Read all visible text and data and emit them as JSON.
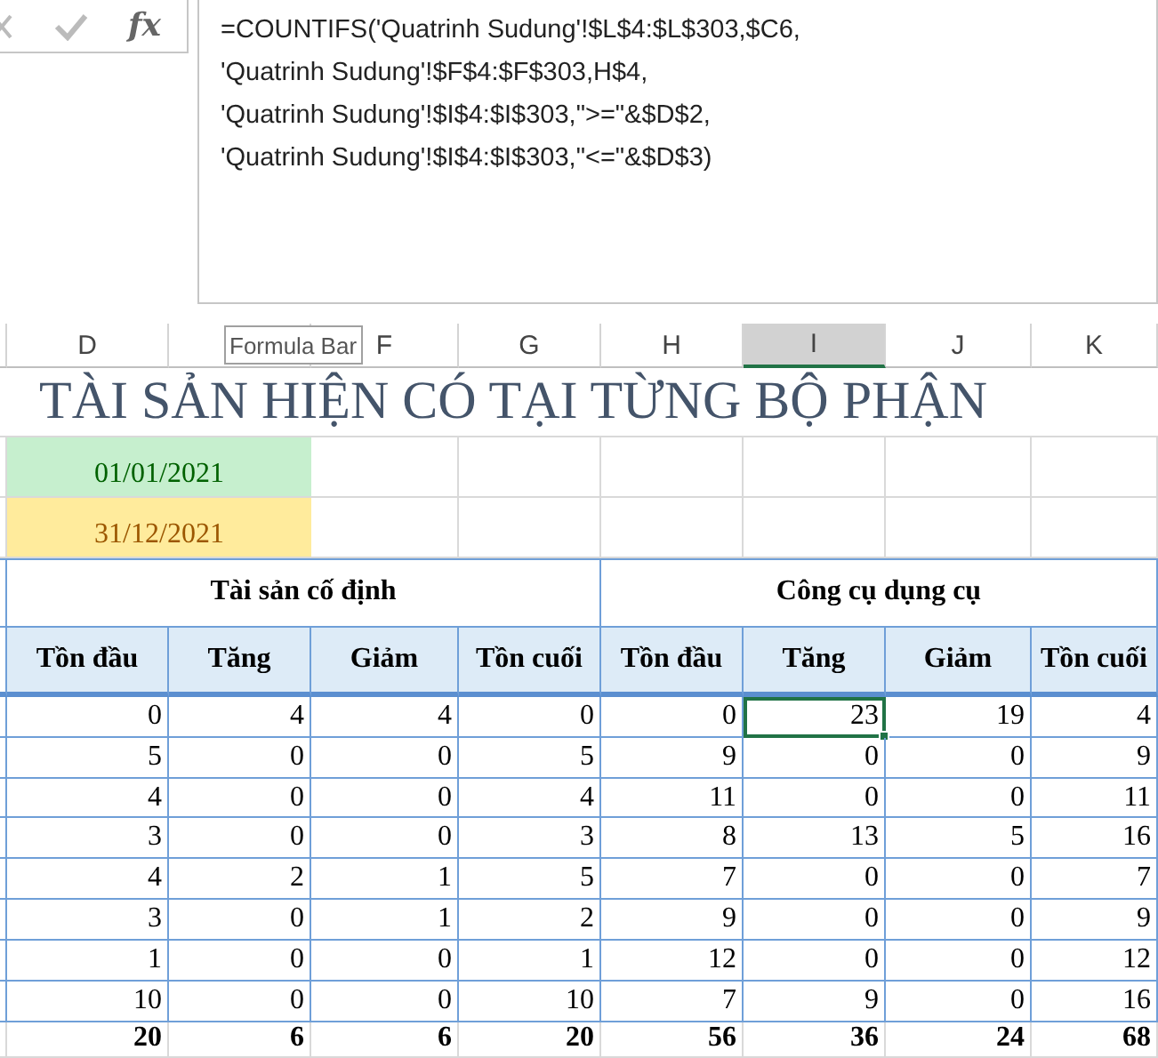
{
  "formula_bar": {
    "function_label": "fx",
    "formula_lines": [
      "=COUNTIFS('Quatrinh Sudung'!$L$4:$L$303,$C6,",
      "'Quatrinh Sudung'!$F$4:$F$303,H$4,",
      "'Quatrinh Sudung'!$I$4:$I$303,\">=\"&$D$2,",
      "'Quatrinh Sudung'!$I$4:$I$303,\"<=\"&$D$3)"
    ]
  },
  "column_headers": [
    {
      "label": "D",
      "selected": false
    },
    {
      "selected": false
    },
    {
      "label": "F",
      "selected": false
    },
    {
      "label": "G",
      "selected": false
    },
    {
      "label": "H",
      "selected": false
    },
    {
      "label": "I",
      "selected": true
    },
    {
      "label": "J",
      "selected": false
    },
    {
      "label": "K",
      "selected": false
    }
  ],
  "tooltip": "Formula Bar",
  "title": "TÀI SẢN HIỆN CÓ TẠI TỪNG BỘ PHẬN",
  "dates": [
    {
      "value": "01/01/2021",
      "kind": "good"
    },
    {
      "value": "31/12/2021",
      "kind": "neutral"
    }
  ],
  "groups": [
    "Tài sản cố định",
    "Công cụ dụng cụ"
  ],
  "subheaders": [
    "Tồn đầu",
    "Tăng",
    "Giảm",
    "Tồn cuối",
    "Tồn đầu",
    "Tăng",
    "Giảm",
    "Tồn cuối"
  ],
  "rows": [
    {
      "total": false,
      "cells": [
        {
          "v": "0",
          "selected": false
        },
        {
          "v": "4",
          "selected": false
        },
        {
          "v": "4",
          "selected": false
        },
        {
          "v": "0",
          "selected": false
        },
        {
          "v": "0",
          "selected": false
        },
        {
          "v": "23",
          "selected": true
        },
        {
          "v": "19",
          "selected": false
        },
        {
          "v": "4",
          "selected": false
        }
      ]
    },
    {
      "total": false,
      "cells": [
        {
          "v": "5",
          "selected": false
        },
        {
          "v": "0",
          "selected": false
        },
        {
          "v": "0",
          "selected": false
        },
        {
          "v": "5",
          "selected": false
        },
        {
          "v": "9",
          "selected": false
        },
        {
          "v": "0",
          "selected": false
        },
        {
          "v": "0",
          "selected": false
        },
        {
          "v": "9",
          "selected": false
        }
      ]
    },
    {
      "total": false,
      "cells": [
        {
          "v": "4",
          "selected": false
        },
        {
          "v": "0",
          "selected": false
        },
        {
          "v": "0",
          "selected": false
        },
        {
          "v": "4",
          "selected": false
        },
        {
          "v": "11",
          "selected": false
        },
        {
          "v": "0",
          "selected": false
        },
        {
          "v": "0",
          "selected": false
        },
        {
          "v": "11",
          "selected": false
        }
      ]
    },
    {
      "total": false,
      "cells": [
        {
          "v": "3",
          "selected": false
        },
        {
          "v": "0",
          "selected": false
        },
        {
          "v": "0",
          "selected": false
        },
        {
          "v": "3",
          "selected": false
        },
        {
          "v": "8",
          "selected": false
        },
        {
          "v": "13",
          "selected": false
        },
        {
          "v": "5",
          "selected": false
        },
        {
          "v": "16",
          "selected": false
        }
      ]
    },
    {
      "total": false,
      "cells": [
        {
          "v": "4",
          "selected": false
        },
        {
          "v": "2",
          "selected": false
        },
        {
          "v": "1",
          "selected": false
        },
        {
          "v": "5",
          "selected": false
        },
        {
          "v": "7",
          "selected": false
        },
        {
          "v": "0",
          "selected": false
        },
        {
          "v": "0",
          "selected": false
        },
        {
          "v": "7",
          "selected": false
        }
      ]
    },
    {
      "total": false,
      "cells": [
        {
          "v": "3",
          "selected": false
        },
        {
          "v": "0",
          "selected": false
        },
        {
          "v": "1",
          "selected": false
        },
        {
          "v": "2",
          "selected": false
        },
        {
          "v": "9",
          "selected": false
        },
        {
          "v": "0",
          "selected": false
        },
        {
          "v": "0",
          "selected": false
        },
        {
          "v": "9",
          "selected": false
        }
      ]
    },
    {
      "total": false,
      "cells": [
        {
          "v": "1",
          "selected": false
        },
        {
          "v": "0",
          "selected": false
        },
        {
          "v": "0",
          "selected": false
        },
        {
          "v": "1",
          "selected": false
        },
        {
          "v": "12",
          "selected": false
        },
        {
          "v": "0",
          "selected": false
        },
        {
          "v": "0",
          "selected": false
        },
        {
          "v": "12",
          "selected": false
        }
      ]
    },
    {
      "total": false,
      "cells": [
        {
          "v": "10",
          "selected": false
        },
        {
          "v": "0",
          "selected": false
        },
        {
          "v": "0",
          "selected": false
        },
        {
          "v": "10",
          "selected": false
        },
        {
          "v": "7",
          "selected": false
        },
        {
          "v": "9",
          "selected": false
        },
        {
          "v": "0",
          "selected": false
        },
        {
          "v": "16",
          "selected": false
        }
      ]
    },
    {
      "total": true,
      "cells": [
        {
          "v": "20",
          "selected": false
        },
        {
          "v": "6",
          "selected": false
        },
        {
          "v": "6",
          "selected": false
        },
        {
          "v": "20",
          "selected": false
        },
        {
          "v": "56",
          "selected": false
        },
        {
          "v": "36",
          "selected": false
        },
        {
          "v": "24",
          "selected": false
        },
        {
          "v": "68",
          "selected": false
        }
      ]
    }
  ]
}
